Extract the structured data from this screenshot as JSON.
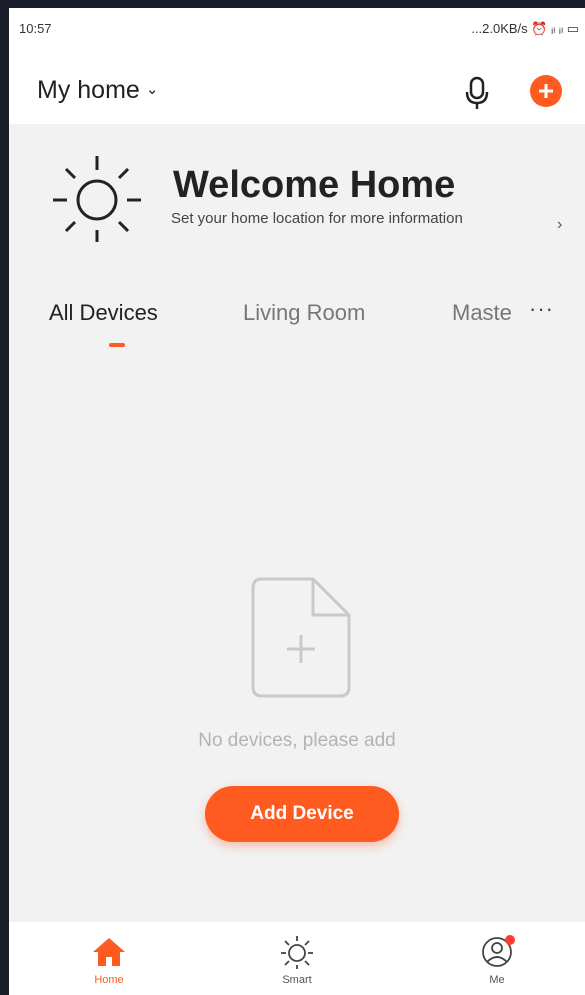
{
  "status_bar": {
    "time": "10:57",
    "indicators": "...2.0KB/s ⏰ ᵢₗ ᵢₗ ▭"
  },
  "header": {
    "home_name": "My home",
    "chevron": "⌄",
    "icons": [
      "microphone-icon",
      "add-circle-icon"
    ]
  },
  "welcome": {
    "title": "Welcome Home",
    "subtitle": "Set your home location for more information",
    "arrow": "›",
    "icon": "sun-icon"
  },
  "tabs": {
    "items": [
      {
        "label": "All Devices",
        "active": true
      },
      {
        "label": "Living Room",
        "active": false
      },
      {
        "label": "Maste",
        "active": false
      }
    ],
    "more": "···"
  },
  "empty_state": {
    "icon": "empty-document-icon",
    "text": "No devices, please add"
  },
  "add_device_button": "Add Device",
  "bottom_nav": [
    {
      "label": "Home",
      "icon": "home-icon",
      "active": true
    },
    {
      "label": "Smart",
      "icon": "smart-sun-icon",
      "active": false
    },
    {
      "label": "Me",
      "icon": "profile-icon",
      "active": false,
      "badge": true
    }
  ],
  "colors": {
    "accent": "#ff5a1f",
    "background": "#f2f2f2",
    "frame": "#1a1f2b"
  }
}
